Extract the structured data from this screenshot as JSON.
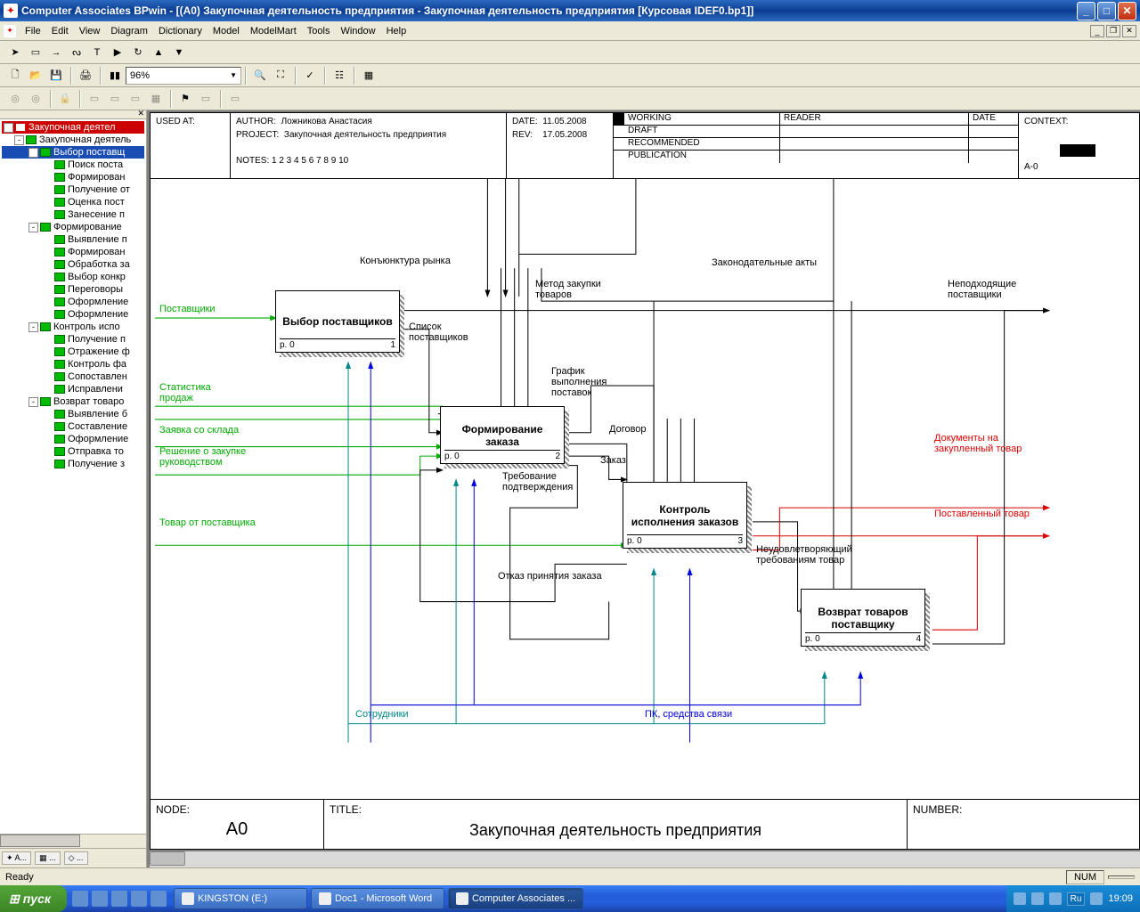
{
  "title": "Computer Associates BPwin - [(A0) Закупочная деятельность предприятия - Закупочная деятельность предприятия  [Курсовая IDEF0.bp1]]",
  "menu": [
    "File",
    "Edit",
    "View",
    "Diagram",
    "Dictionary",
    "Model",
    "ModelMart",
    "Tools",
    "Window",
    "Help"
  ],
  "zoom": "96%",
  "tree": {
    "root": "Закупочная деятел",
    "items": [
      {
        "l": 1,
        "t": "Закупочная деятель",
        "exp": "-"
      },
      {
        "l": 2,
        "t": "Выбор поставщ",
        "sel": true,
        "exp": "-"
      },
      {
        "l": 3,
        "t": "Поиск поста"
      },
      {
        "l": 3,
        "t": "Формирован"
      },
      {
        "l": 3,
        "t": "Получение от"
      },
      {
        "l": 3,
        "t": "Оценка пост"
      },
      {
        "l": 3,
        "t": "Занесение п"
      },
      {
        "l": 2,
        "t": "Формирование",
        "exp": "-"
      },
      {
        "l": 3,
        "t": "Выявление п"
      },
      {
        "l": 3,
        "t": "Формирован"
      },
      {
        "l": 3,
        "t": "Обработка за"
      },
      {
        "l": 3,
        "t": "Выбор конкр"
      },
      {
        "l": 3,
        "t": "Переговоры"
      },
      {
        "l": 3,
        "t": "Оформление"
      },
      {
        "l": 3,
        "t": "Оформление"
      },
      {
        "l": 2,
        "t": "Контроль испо",
        "exp": "-"
      },
      {
        "l": 3,
        "t": "Получение п"
      },
      {
        "l": 3,
        "t": "Отражение ф"
      },
      {
        "l": 3,
        "t": "Контроль фа"
      },
      {
        "l": 3,
        "t": "Сопоставлен"
      },
      {
        "l": 3,
        "t": "Исправлени"
      },
      {
        "l": 2,
        "t": "Возврат товаро",
        "exp": "-"
      },
      {
        "l": 3,
        "t": "Выявление б"
      },
      {
        "l": 3,
        "t": "Составление"
      },
      {
        "l": 3,
        "t": "Оформление"
      },
      {
        "l": 3,
        "t": "Отправка то"
      },
      {
        "l": 3,
        "t": "Получение з"
      }
    ]
  },
  "header": {
    "used_at": "USED AT:",
    "author_label": "AUTHOR:",
    "author": "Ложникова Анастасия",
    "project_label": "PROJECT:",
    "project": "Закупочная деятельность предприятия",
    "notes": "NOTES:  1  2  3  4  5  6  7  8  9  10",
    "date_label": "DATE:",
    "date": "11.05.2008",
    "rev_label": "REV:",
    "rev": "17.05.2008",
    "statuses": [
      "WORKING",
      "DRAFT",
      "RECOMMENDED",
      "PUBLICATION"
    ],
    "reader": "READER",
    "date_h": "DATE",
    "context": "CONTEXT:",
    "context_val": "A-0"
  },
  "footer": {
    "node_label": "NODE:",
    "node": "A0",
    "title_label": "TITLE:",
    "title": "Закупочная деятельность предприятия",
    "number_label": "NUMBER:"
  },
  "boxes": {
    "b1": {
      "title": "Выбор поставщиков",
      "p": "p. 0",
      "n": "1"
    },
    "b2": {
      "title": "Формирование заказа",
      "p": "p. 0",
      "n": "2"
    },
    "b3": {
      "title": "Контроль исполнения заказов",
      "p": "p. 0",
      "n": "3"
    },
    "b4": {
      "title": "Возврат товаров поставщику",
      "p": "p. 0",
      "n": "4"
    }
  },
  "labels": {
    "suppliers": "Поставщики",
    "sales_stat": "Статистика продаж",
    "stock_req": "Заявка со склада",
    "mgmt_dec": "Решение о закупке руководством",
    "from_supplier": "Товар от поставщика",
    "market": "Конъюнктура рынка",
    "method": "Метод закупки товаров",
    "laws": "Законодательные акты",
    "supplier_list": "Список поставщиков",
    "schedule": "График выполнения поставок",
    "contract": "Договор",
    "order": "Заказ",
    "confirm_req": "Требование подтверждения",
    "reject": "Отказ принятия заказа",
    "bad_supp": "Неподходящие поставщики",
    "bad_goods": "Неудовлетворяющий требованиям товар",
    "docs": "Документы на закупленный товар",
    "delivered": "Поставленный товар",
    "staff": "Сотрудники",
    "pc": "ПК, средства связи"
  },
  "status": "Ready",
  "status_num": "NUM",
  "taskbar": {
    "start": "пуск",
    "tasks": [
      {
        "t": "KINGSTON (E:)",
        "active": false
      },
      {
        "t": "Doc1 - Microsoft Word",
        "active": false
      },
      {
        "t": "Computer Associates ...",
        "active": true
      }
    ],
    "lang": "Ru",
    "time": "19:09"
  }
}
